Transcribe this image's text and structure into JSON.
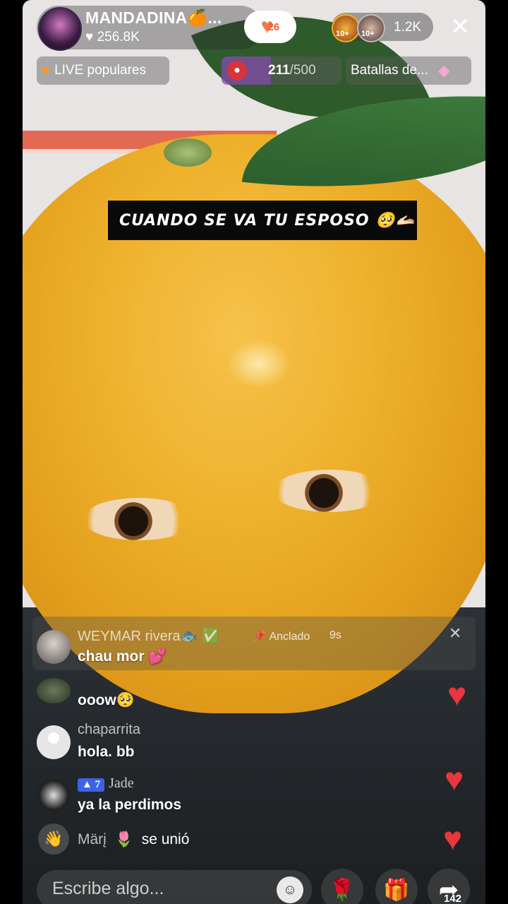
{
  "header": {
    "host_name": "MANDADINA🍊...",
    "likes": "256.8K",
    "follow_label": "26",
    "viewer_badges": [
      "10+",
      "10+"
    ],
    "viewer_count": "1.2K",
    "close_glyph": "✕"
  },
  "pills": {
    "live_label": "LIVE populares",
    "goal_current": "211",
    "goal_total": "/500",
    "battles_label": "Batallas de..."
  },
  "caption": "CUANDO SE VA TU ESPOSO 🥺🫴🏻",
  "chat": {
    "pinned": {
      "name": "WEYMAR rivera🐟 ✅",
      "pinned_label": "Anclado",
      "time": "9s",
      "message": "chau  mor 💕"
    },
    "messages": [
      {
        "name": "",
        "message": "ooow🥺"
      },
      {
        "name": "chaparrita",
        "message": "hola. bb"
      },
      {
        "badge": "7",
        "name": "Jade",
        "message": "ya la perdimos"
      },
      {
        "name": "Märį",
        "joined_icon": "🌷",
        "message": "se unió"
      }
    ]
  },
  "bottom": {
    "input_placeholder": "Escribe algo...",
    "emoji_icon": "☺",
    "rose_icon": "🌹",
    "gift_icon": "🎁",
    "share_count": "142"
  },
  "colors": {
    "heart": "#e8373d",
    "goal_fill": "#9646d2",
    "badge": "#3c63e6"
  }
}
